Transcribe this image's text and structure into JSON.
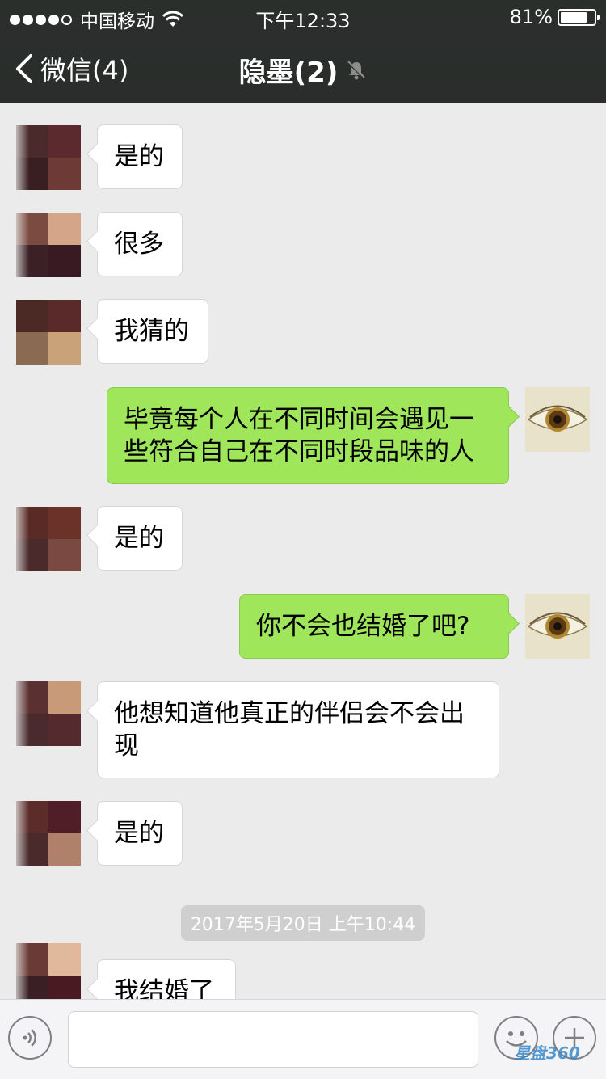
{
  "status_bar": {
    "carrier": "中国移动",
    "time": "下午12:33",
    "battery_text": "81%",
    "battery_level": 0.81
  },
  "nav": {
    "back_label": "微信(4)",
    "title": "隐墨(2)"
  },
  "messages": [
    {
      "side": "in",
      "text": "是的"
    },
    {
      "side": "in",
      "text": "很多"
    },
    {
      "side": "in",
      "text": "我猜的"
    },
    {
      "side": "out",
      "text": "毕竟每个人在不同时间会遇见一些符合自己在不同时段品味的人"
    },
    {
      "side": "in",
      "text": "是的"
    },
    {
      "side": "out",
      "text": "你不会也结婚了吧?"
    },
    {
      "side": "in",
      "text": "他想知道他真正的伴侣会不会出现"
    },
    {
      "side": "in",
      "text": "是的"
    },
    {
      "side": "in",
      "text": "我结婚了"
    }
  ],
  "timestamp": "2017年5月20日 上午10:44",
  "watermark": "星盘360",
  "colors": {
    "header_bg": "#2b2f2c",
    "chat_bg": "#ebebeb",
    "outgoing_bubble": "#9fe65b",
    "incoming_bubble": "#ffffff"
  }
}
